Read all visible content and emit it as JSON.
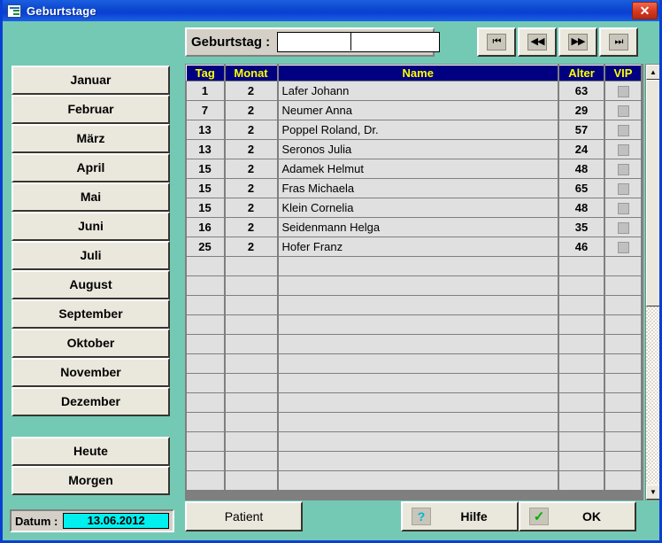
{
  "window": {
    "title": "Geburtstage",
    "icon": "form-list-icon",
    "close_label": "✕",
    "accent_titlebar": "#0a3fd4",
    "background": "#74c9b5",
    "button_face": "#eae7dc",
    "header_bg": "#000080",
    "header_fg": "#ffff00",
    "highlight_cell": "#ffff00"
  },
  "search": {
    "label": "Geburtstag :",
    "value": "",
    "placeholder": ""
  },
  "nav": {
    "first": "⏮",
    "prev": "◀◀",
    "next": "▶▶",
    "last": "⏭",
    "first_name": "first-record-icon",
    "prev_name": "previous-record-icon",
    "next_name": "next-record-icon",
    "last_name": "last-record-icon"
  },
  "sidebar": {
    "months": [
      {
        "label": "Januar"
      },
      {
        "label": "Februar"
      },
      {
        "label": "März"
      },
      {
        "label": "April"
      },
      {
        "label": "Mai"
      },
      {
        "label": "Juni"
      },
      {
        "label": "Juli"
      },
      {
        "label": "August"
      },
      {
        "label": "September"
      },
      {
        "label": "Oktober"
      },
      {
        "label": "November"
      },
      {
        "label": "Dezember"
      }
    ],
    "actions": [
      {
        "label": "Heute"
      },
      {
        "label": "Morgen"
      }
    ]
  },
  "datum": {
    "label": "Datum :",
    "value": "13.06.2012",
    "value_bg": "#00f0f0"
  },
  "grid": {
    "columns": [
      "Tag",
      "Monat",
      "Name",
      "Alter",
      "VIP"
    ],
    "rows": [
      {
        "tag": "1",
        "monat": "2",
        "name": "Lafer Johann",
        "alter": "63",
        "vip": false
      },
      {
        "tag": "7",
        "monat": "2",
        "name": "Neumer Anna",
        "alter": "29",
        "vip": false
      },
      {
        "tag": "13",
        "monat": "2",
        "name": "Poppel Roland, Dr.",
        "alter": "57",
        "vip": false
      },
      {
        "tag": "13",
        "monat": "2",
        "name": "Seronos Julia",
        "alter": "24",
        "vip": false
      },
      {
        "tag": "15",
        "monat": "2",
        "name": "Adamek Helmut",
        "alter": "48",
        "vip": false
      },
      {
        "tag": "15",
        "monat": "2",
        "name": "Fras Michaela",
        "alter": "65",
        "vip": false
      },
      {
        "tag": "15",
        "monat": "2",
        "name": "Klein Cornelia",
        "alter": "48",
        "vip": false
      },
      {
        "tag": "16",
        "monat": "2",
        "name": "Seidenmann Helga",
        "alter": "35",
        "vip": false
      },
      {
        "tag": "25",
        "monat": "2",
        "name": "Hofer Franz",
        "alter": "46",
        "vip": false
      }
    ],
    "empty_row_count": 12
  },
  "footer": {
    "patient": "Patient",
    "help": "Hilfe",
    "ok": "OK",
    "help_glyph": "?",
    "ok_glyph": "✓"
  },
  "scrollbar": {
    "up_glyph": "▲",
    "down_glyph": "▼"
  }
}
